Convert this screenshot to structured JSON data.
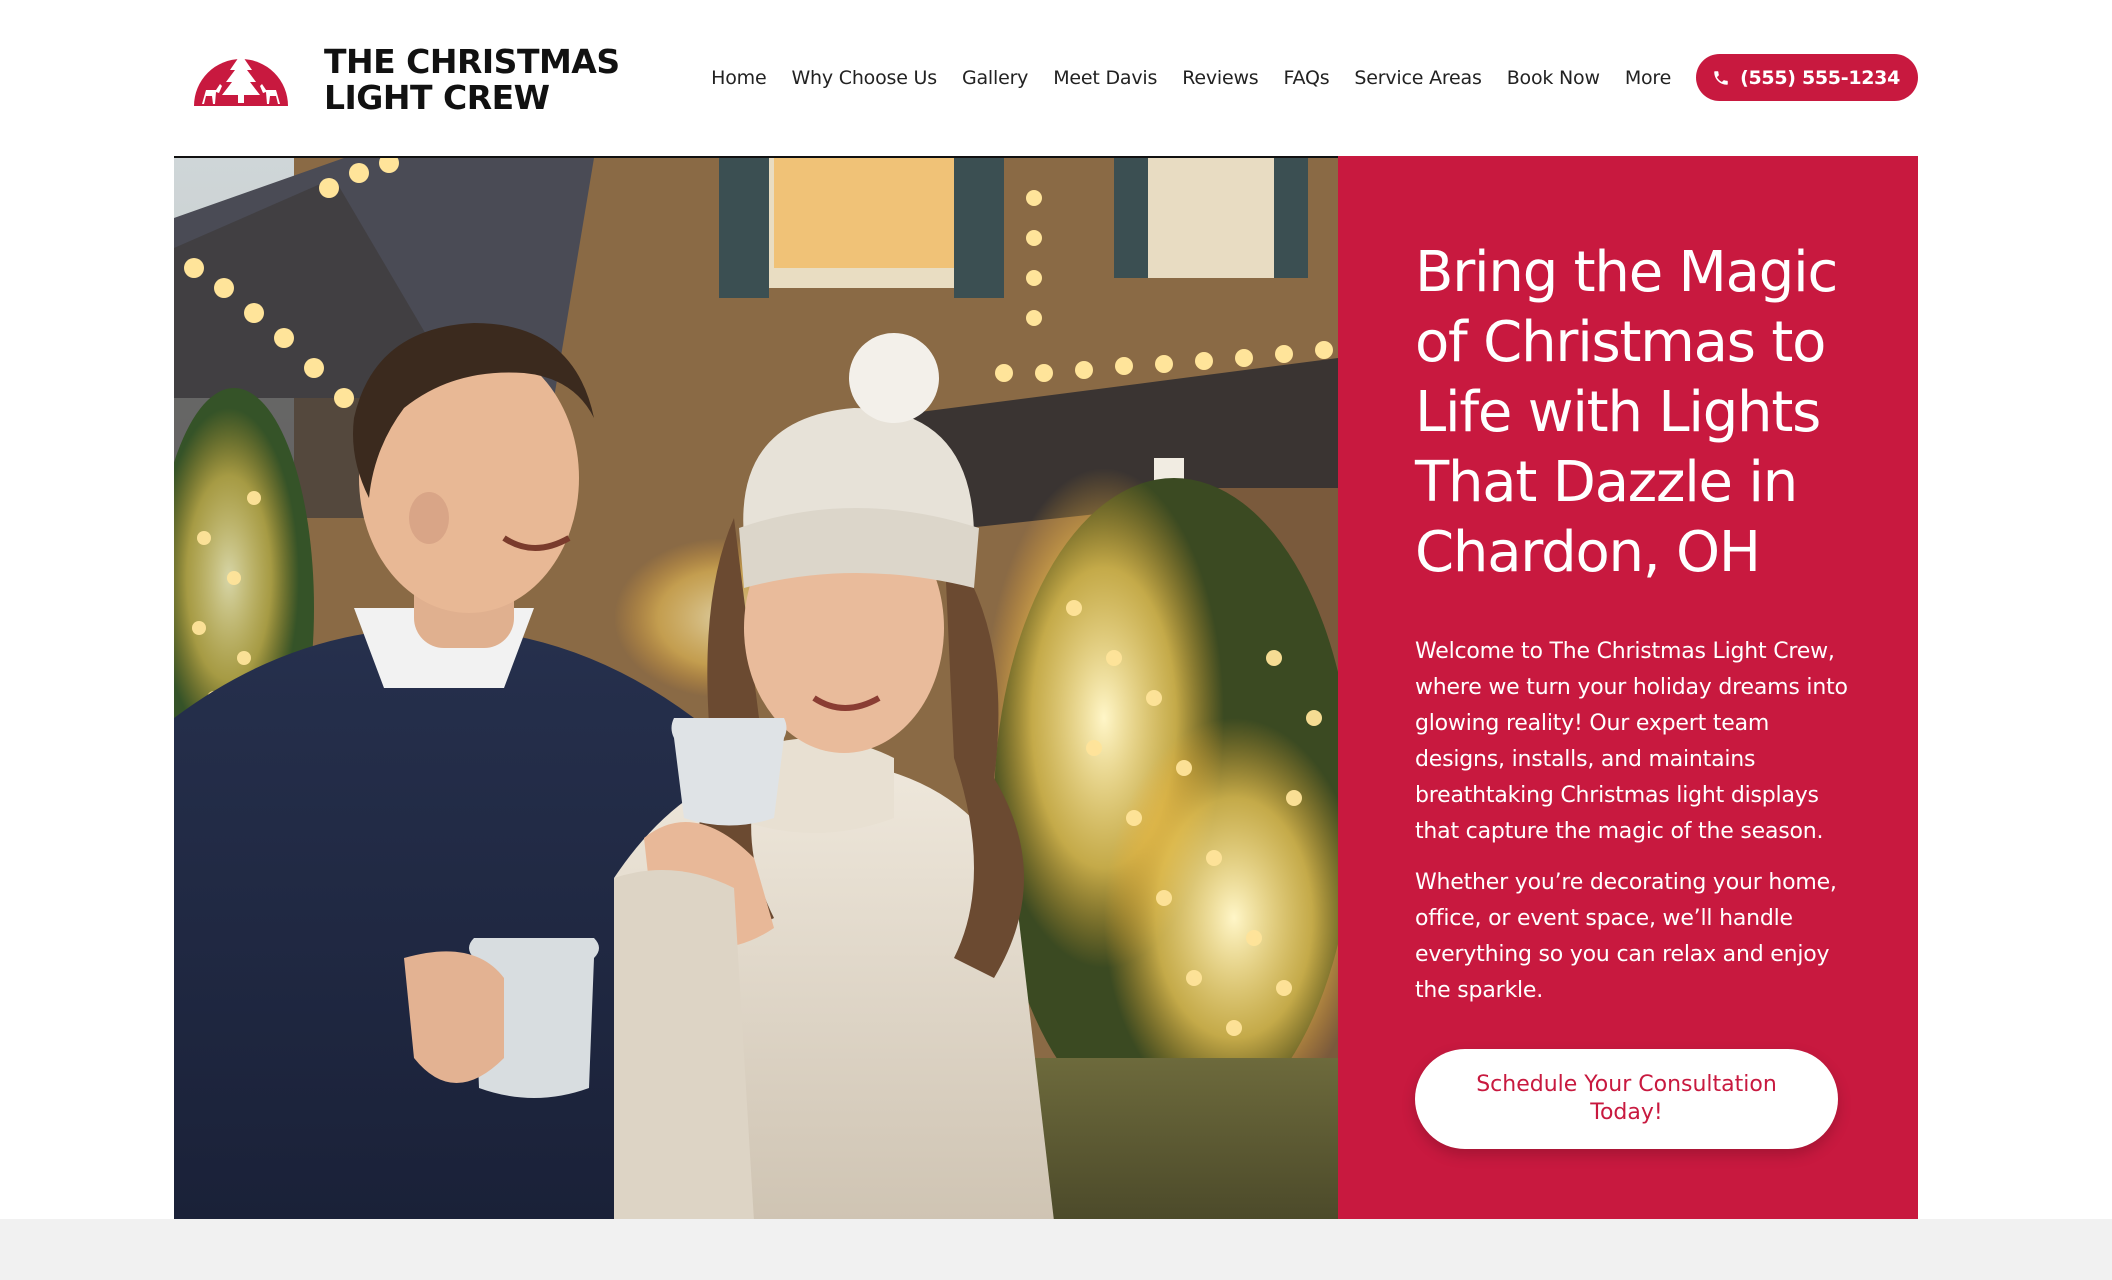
{
  "brand": {
    "line1": "THE CHRISTMAS",
    "line2": "LIGHT CREW",
    "badge_icon": "tree-and-reindeer-logo-icon"
  },
  "nav": {
    "items": [
      "Home",
      "Why Choose Us",
      "Gallery",
      "Meet Davis",
      "Reviews",
      "FAQs",
      "Service Areas",
      "Book Now",
      "More"
    ],
    "phone_label": "(555) 555-1234",
    "phone_icon": "phone-icon"
  },
  "hero": {
    "title": "Bring the Magic of Christmas to Life with Lights That Dazzle in Chardon, OH",
    "paragraph1": "Welcome to The Christmas Light Crew, where we turn your holiday dreams into glowing reality! Our expert team designs, installs, and maintains breathtaking Christmas light displays that capture the magic of the season.",
    "paragraph2": "Whether you’re decorating your home, office, or event space, we’ll handle everything so you can relax and enjoy the sparkle.",
    "cta_label": "Schedule Your Consultation Today!"
  },
  "colors": {
    "accent": "#c8193f",
    "text": "#1a1a1a",
    "panel_text": "#ffffff"
  }
}
